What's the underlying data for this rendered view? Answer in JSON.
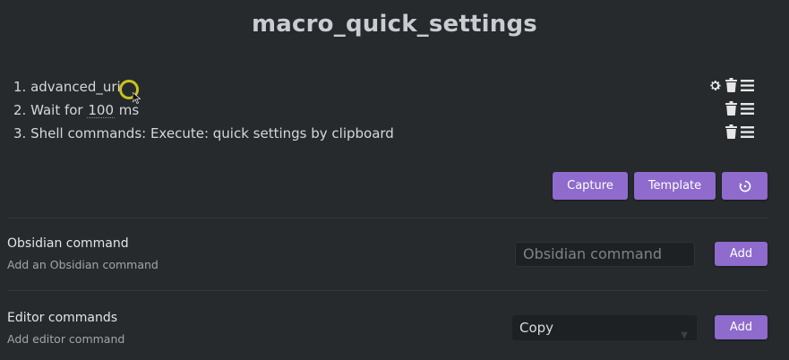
{
  "macro": {
    "title": "macro_quick_settings"
  },
  "commands": [
    {
      "number": "1.",
      "label": "advanced_uri"
    },
    {
      "number": "2.",
      "label_prefix": "Wait for ",
      "wait_value": "100",
      "label_suffix": " ms"
    },
    {
      "number": "3.",
      "label": "Shell commands: Execute: quick settings by clipboard"
    }
  ],
  "toolbar": {
    "capture_label": "Capture",
    "template_label": "Template",
    "reset_icon": "rotate-icon"
  },
  "obsidian_command": {
    "name": "Obsidian command",
    "description": "Add an Obsidian command",
    "placeholder": "Obsidian command",
    "add_label": "Add"
  },
  "editor_commands": {
    "name": "Editor commands",
    "description": "Add editor command",
    "selected": "Copy",
    "add_label": "Add"
  },
  "colors": {
    "background": "#262a2d",
    "accent": "#8e6bcc",
    "cursor_highlight": "#c9c31a"
  }
}
